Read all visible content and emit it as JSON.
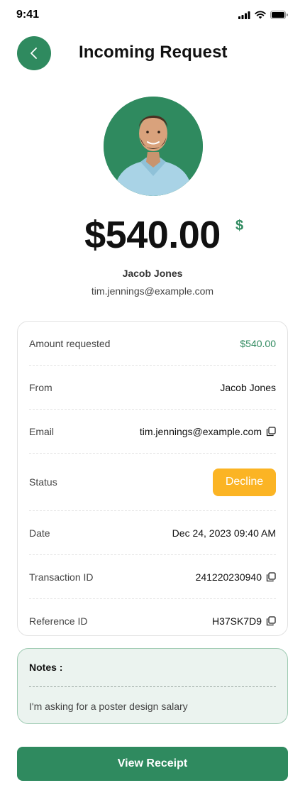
{
  "status_bar": {
    "time": "9:41"
  },
  "header": {
    "title": "Incoming Request"
  },
  "amount": {
    "value": "$540.00",
    "currency_symbol": "$"
  },
  "requester": {
    "name": "Jacob Jones",
    "email": "tim.jennings@example.com"
  },
  "details": {
    "rows": [
      {
        "label": "Amount requested",
        "value": "$540.00"
      },
      {
        "label": "From",
        "value": "Jacob Jones"
      },
      {
        "label": "Email",
        "value": "tim.jennings@example.com"
      },
      {
        "label": "Status",
        "value": "Decline"
      },
      {
        "label": "Date",
        "value": "Dec 24, 2023 09:40 AM"
      },
      {
        "label": "Transaction ID",
        "value": "241220230940"
      },
      {
        "label": "Reference ID",
        "value": "H37SK7D9"
      }
    ]
  },
  "notes": {
    "title": "Notes :",
    "text": "I'm asking for a poster design salary"
  },
  "actions": {
    "view_receipt": "View Receipt"
  },
  "colors": {
    "accent": "#2f8a5f",
    "status_warning": "#fbb424",
    "notes_bg": "#ebf3ef"
  }
}
